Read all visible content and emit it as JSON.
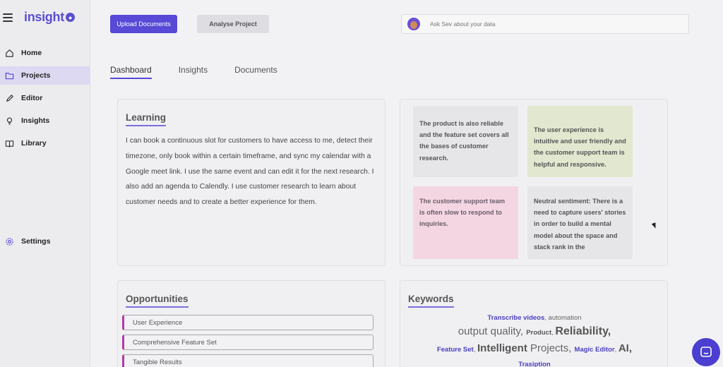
{
  "app": {
    "logo": "insight"
  },
  "sidebar": {
    "items": [
      {
        "label": "Home",
        "icon": "home-icon",
        "active": false
      },
      {
        "label": "Projects",
        "icon": "folder-icon",
        "active": true
      },
      {
        "label": "Editor",
        "icon": "pencil-icon",
        "active": false
      },
      {
        "label": "Insights",
        "icon": "lightbulb-icon",
        "active": false
      },
      {
        "label": "Library",
        "icon": "book-icon",
        "active": false
      }
    ],
    "settings_label": "Settings"
  },
  "toolbar": {
    "upload_label": "Upload Documents",
    "analyse_label": "Analyse Project",
    "ask_placeholder": "Ask Sev about your data"
  },
  "tabs": [
    {
      "label": "Dashboard",
      "active": true
    },
    {
      "label": "Insights",
      "active": false
    },
    {
      "label": "Documents",
      "active": false
    }
  ],
  "learning": {
    "title": "Learning",
    "text": "I can book a continuous slot for customers to have access to me, detect their timezone, only book within a certain timeframe, and sync my calendar with a Google meet link. I use the same event and can edit it for the next research. I also add an agenda to Calendly. I use customer research to learn about customer needs and to create a better experience for them."
  },
  "notes": [
    {
      "text": "The product is also reliable and the feature set covers all the bases of customer research.",
      "color": "#e6e6e8"
    },
    {
      "text": "The user experience is intuitive and user friendly and the customer support team is helpful and responsive.",
      "color": "#e1e8cf"
    },
    {
      "text": "The customer support team is often slow to respond to inquiries.",
      "color": "#f4d6e2"
    },
    {
      "text": "Neutral sentiment: There is a need to capture users' stories in order to build a mental model about the space and stack rank in the",
      "color": "#e6e6e8"
    }
  ],
  "opportunities": {
    "title": "Opportunities",
    "items": [
      "User Experience",
      "Comprehensive Feature Set",
      "Tangible Results"
    ]
  },
  "keywords": {
    "title": "Keywords",
    "words": [
      "Transcribe videos",
      "automation",
      "output quality",
      "Product",
      "Reliability",
      "Feature Set",
      "Intelligent",
      "Projects",
      "Magic Editor",
      "AI",
      "Trasiption"
    ]
  },
  "colors": {
    "accent": "#5849d6",
    "highlight": "#b03aa6"
  }
}
